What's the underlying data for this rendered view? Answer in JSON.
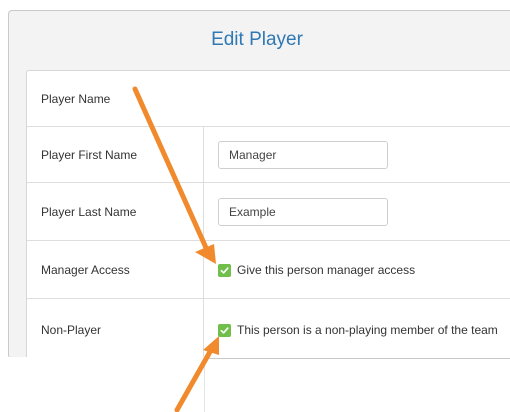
{
  "dialog": {
    "title": "Edit Player"
  },
  "form": {
    "rows": [
      {
        "label": "Player Name"
      },
      {
        "label": "Player First Name",
        "value": "Manager"
      },
      {
        "label": "Player Last Name",
        "value": "Example"
      },
      {
        "label": "Manager Access",
        "checkbox_label": "Give this person manager access",
        "checked": true
      },
      {
        "label": "Non-Player",
        "checkbox_label": "This person is a non-playing member of the team",
        "checked": true
      }
    ]
  },
  "colors": {
    "title": "#2f78b3",
    "checkbox": "#6fbf4a",
    "annotation_arrow": "#f08a2c"
  },
  "annotations": {
    "arrow_icon": "orange-arrow"
  }
}
